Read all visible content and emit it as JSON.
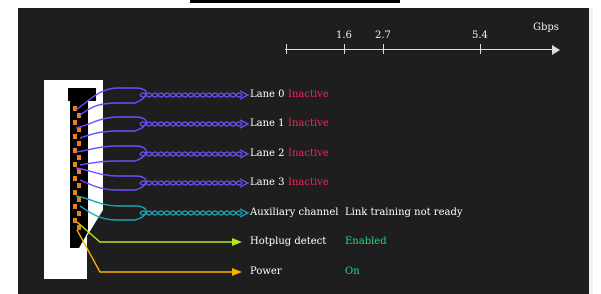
{
  "scale": {
    "unit": "Gbps",
    "ticks": [
      "1.6",
      "2.7",
      "5.4"
    ]
  },
  "lanes": [
    {
      "label": "Lane 0",
      "status": "Inactive"
    },
    {
      "label": "Lane 1",
      "status": "Inactive"
    },
    {
      "label": "Lane 2",
      "status": "Inactive"
    },
    {
      "label": "Lane 3",
      "status": "Inactive"
    }
  ],
  "aux": {
    "label": "Auxiliary channel",
    "status": "Link training not ready"
  },
  "hotplug": {
    "label": "Hotplug detect",
    "status": "Enabled"
  },
  "power": {
    "label": "Power",
    "status": "On"
  },
  "colors": {
    "lane": "#6a4fff",
    "aux": "#1aa7b5",
    "hotplug": "#b9e61f",
    "power": "#ffb000",
    "inactive": "#ff1f5b",
    "enabled": "#21d97a"
  }
}
